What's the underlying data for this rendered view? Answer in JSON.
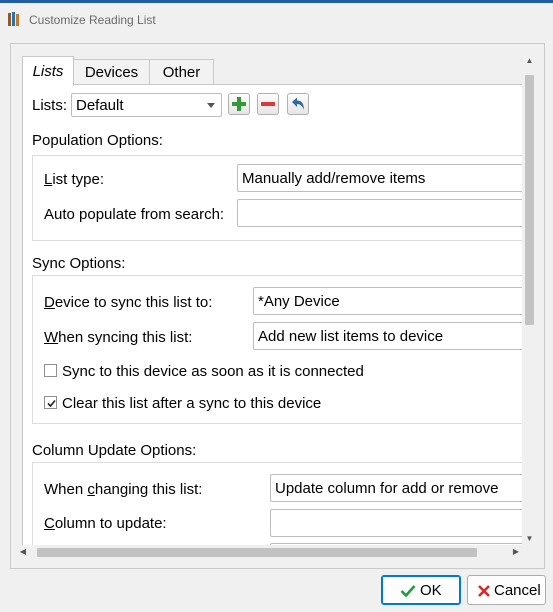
{
  "window": {
    "title": "Customize Reading List"
  },
  "tabs": [
    {
      "label": "Lists"
    },
    {
      "label": "Devices"
    },
    {
      "label": "Other"
    }
  ],
  "lists": {
    "label": "Lists:",
    "selected": "Default",
    "icons": [
      "add-icon",
      "remove-icon",
      "undo-icon"
    ]
  },
  "population": {
    "heading": "Population Options:",
    "list_type": {
      "label_u": "L",
      "label_rest": "ist type:",
      "value": "Manually add/remove items"
    },
    "auto_populate": {
      "label": "Auto populate from search:",
      "value": ""
    }
  },
  "sync": {
    "heading": "Sync Options:",
    "device": {
      "label_u": "D",
      "label_rest": "evice to sync this list to:",
      "value": "*Any Device"
    },
    "when": {
      "label_u": "W",
      "label_rest": "hen syncing this list:",
      "value": "Add new list items to device"
    },
    "sync_on_connect": {
      "label": "Sync to this device as soon as it is connected",
      "checked": false
    },
    "clear_after_sync": {
      "label": "Clear this list after a sync to this device",
      "checked": true
    }
  },
  "column_update": {
    "heading": "Column Update Options:",
    "when_changing": {
      "label_pre": "When ",
      "label_u": "c",
      "label_rest": "hanging this list:",
      "value": "Update column for add or remove"
    },
    "column_to_update": {
      "label_u": "C",
      "label_rest": "olumn to update:",
      "value": ""
    }
  },
  "buttons": {
    "ok": "OK",
    "cancel": "Cancel"
  },
  "colors": {
    "title_bar_line": "#1f5ea6",
    "ok_check": "#1e9b3a",
    "cancel_x": "#d42a2a",
    "add_green": "#2e9b35",
    "remove_red": "#d93a3a",
    "undo_blue": "#2f6aa0"
  }
}
